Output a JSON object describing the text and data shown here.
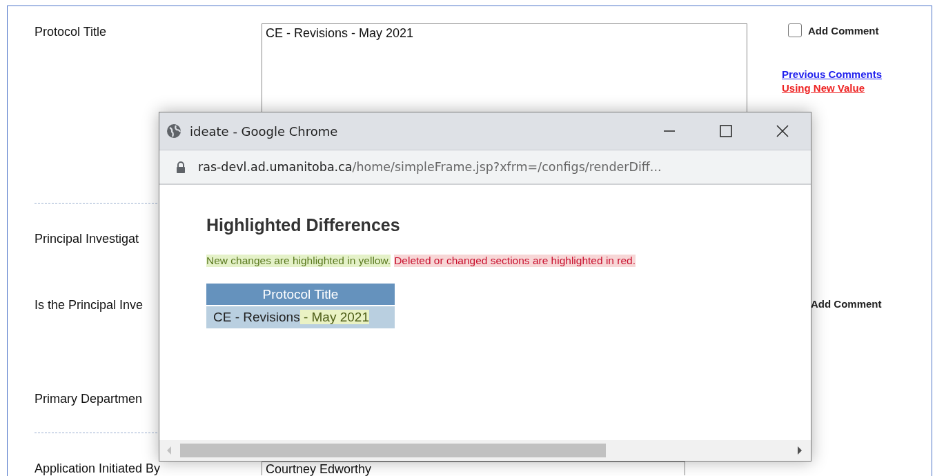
{
  "form_rows": [
    {
      "label": "Protocol Title",
      "field": {
        "kind": "textarea",
        "value": "CE - Revisions - May 2021"
      },
      "add_comment": {
        "label": "Add Comment",
        "checked": false
      },
      "links": [
        {
          "text": "Previous Comments",
          "kind": "info"
        },
        {
          "text": "Using New Value",
          "kind": "alert"
        }
      ],
      "divider_after": true
    },
    {
      "label": "Principal Investigat",
      "divider_after": false
    },
    {
      "label": "Is the Principal Inve",
      "add_comment": {
        "label": "Add Comment"
      },
      "divider_after": false
    },
    {
      "label": "Primary Departmen",
      "divider_after": true
    },
    {
      "label": "Application Initiated By",
      "field": {
        "kind": "text",
        "value": "Courtney Edworthy"
      },
      "divider_after": false
    }
  ],
  "popup": {
    "title": "ideate - Google Chrome",
    "url_host": "ras-devl.ad.umanitoba.ca",
    "url_path": "/home/simpleFrame.jsp?xfrm=/configs/renderDiff...",
    "heading": "Highlighted Differences",
    "legend": [
      {
        "text": "New changes are highlighted in yellow.",
        "kind": "added"
      },
      {
        "text": "Deleted or changed sections are highlighted in red.",
        "kind": "deleted"
      }
    ],
    "table": {
      "columns": [
        "Protocol Title"
      ],
      "rows": [
        [
          [
            {
              "text": "CE - Revisions",
              "kind": "plain"
            },
            {
              "text": " - May 2021",
              "kind": "added"
            }
          ]
        ]
      ]
    }
  }
}
